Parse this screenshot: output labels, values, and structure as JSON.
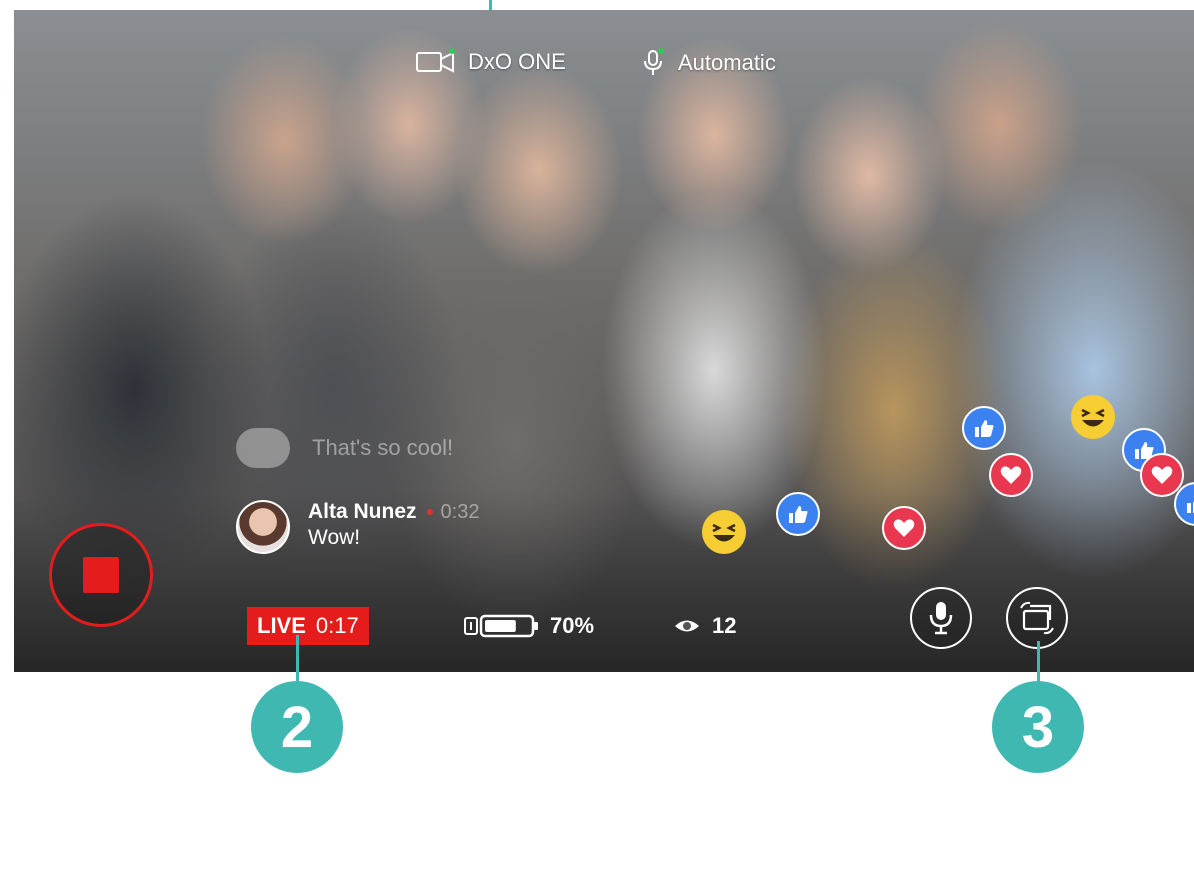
{
  "camera": {
    "device": "DxO ONE",
    "status_color": "#34c759"
  },
  "microphone": {
    "mode": "Automatic"
  },
  "comments": [
    {
      "text": "That's so cool!"
    },
    {
      "name": "Alta Nunez",
      "time": "0:32",
      "message": "Wow!"
    }
  ],
  "live": {
    "label": "LIVE",
    "elapsed": "0:17",
    "color": "#e51c1c"
  },
  "battery": {
    "percent": "70%",
    "level": 0.7
  },
  "viewers": {
    "count": "12"
  },
  "controls": {
    "stop": "stop-icon",
    "mic": "microphone-icon",
    "switch": "switch-camera-icon"
  },
  "reactions": [
    "like",
    "love",
    "haha"
  ],
  "callouts": {
    "bottom_left": "2",
    "bottom_right": "3",
    "color": "#3fb8b2"
  }
}
